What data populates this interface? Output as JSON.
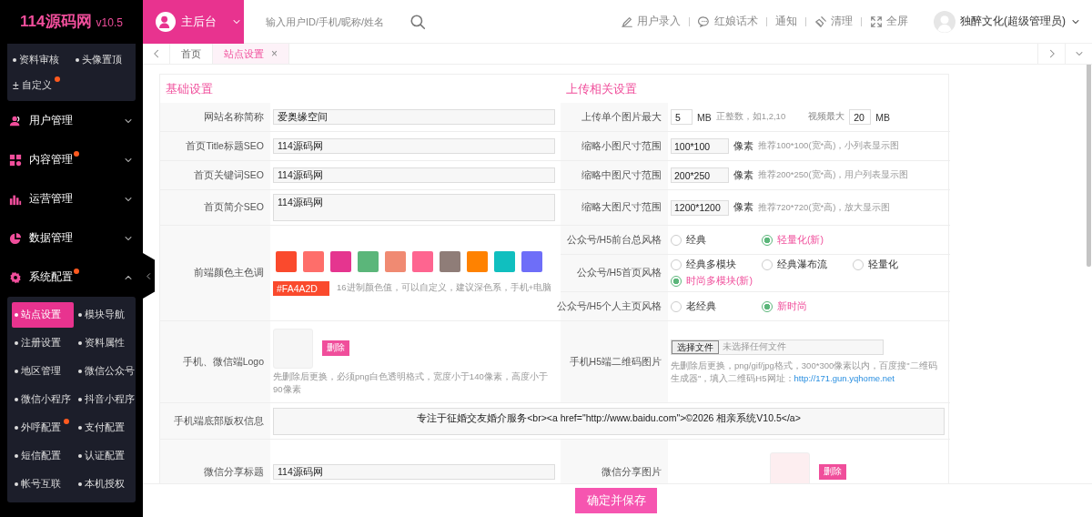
{
  "header": {
    "logo": "114源码网",
    "version": "v10.5",
    "console": "主后台",
    "search_placeholder": "输入用户ID/手机/昵称/姓名",
    "actions": [
      {
        "kind": "pen",
        "label": "用户录入"
      },
      {
        "kind": "chat",
        "label": "红娘话术"
      },
      {
        "kind": "plain",
        "label": "通知"
      },
      {
        "kind": "broom",
        "label": "清理"
      },
      {
        "kind": "expand",
        "label": "全屏"
      }
    ],
    "user": "独醉文化(超级管理员)"
  },
  "sidebar": {
    "top_items": [
      {
        "label": "资料审核",
        "dot": false
      },
      {
        "label": "头像置顶",
        "dot": false
      },
      {
        "label": "自定义",
        "symbol": "±",
        "dot": true
      }
    ],
    "menus": [
      {
        "kind": "user",
        "label": "用户管理",
        "dot": false,
        "expanded": false
      },
      {
        "kind": "grid",
        "label": "内容管理",
        "dot": true,
        "expanded": false
      },
      {
        "kind": "bars",
        "label": "运营管理",
        "dot": false,
        "expanded": false
      },
      {
        "kind": "pie",
        "label": "数据管理",
        "dot": false,
        "expanded": false
      },
      {
        "kind": "gear",
        "label": "系统配置",
        "dot": true,
        "expanded": true,
        "children": [
          {
            "label": "站点设置",
            "selected": true,
            "dot": false
          },
          {
            "label": "模块导航",
            "selected": false,
            "dot": false
          },
          {
            "label": "注册设置",
            "selected": false,
            "dot": false
          },
          {
            "label": "资料属性",
            "selected": false,
            "dot": false
          },
          {
            "label": "地区管理",
            "selected": false,
            "dot": false
          },
          {
            "label": "微信公众号",
            "selected": false,
            "dot": false
          },
          {
            "label": "微信小程序",
            "selected": false,
            "dot": false
          },
          {
            "label": "抖音小程序",
            "selected": false,
            "dot": false
          },
          {
            "label": "外呼配置",
            "selected": false,
            "dot": true
          },
          {
            "label": "支付配置",
            "selected": false,
            "dot": false
          },
          {
            "label": "短信配置",
            "selected": false,
            "dot": false
          },
          {
            "label": "认证配置",
            "selected": false,
            "dot": false
          },
          {
            "label": "帐号互联",
            "selected": false,
            "dot": false
          },
          {
            "label": "本机授权",
            "selected": false,
            "dot": false
          }
        ]
      }
    ]
  },
  "tabs": [
    {
      "label": "首页",
      "selected": false,
      "closable": false
    },
    {
      "label": "站点设置",
      "selected": true,
      "closable": true,
      "close": "×"
    }
  ],
  "form": {
    "left_title": "基础设置",
    "right_title": "上传相关设置",
    "left_fields": [
      {
        "kind": "text",
        "label": "网站名称简称",
        "value": "爱奥缘空间"
      },
      {
        "kind": "text",
        "label": "首页Title标题SEO",
        "value": "114源码网"
      },
      {
        "kind": "text",
        "label": "首页关键词SEO",
        "value": "114源码网"
      },
      {
        "kind": "textarea",
        "label": "首页简介SEO",
        "value": "114源码网"
      },
      {
        "kind": "colors",
        "label": "前端颜色主色调",
        "swatches": [
          {
            "color": "#fa4a2d"
          },
          {
            "color": "#fe6e6a"
          },
          {
            "color": "#e5358f"
          },
          {
            "color": "#5bb67a"
          },
          {
            "color": "#f08a72"
          },
          {
            "color": "#fe6590"
          },
          {
            "color": "#8f7d78"
          },
          {
            "color": "#ff8200"
          },
          {
            "color": "#10bfbf"
          },
          {
            "color": "#6e6ef8"
          }
        ],
        "value": "#FA4A2D",
        "color": "#fa4a2d",
        "hint": "16进制颜色值，可以自定义，建议深色系，手机+电脑"
      },
      {
        "kind": "image",
        "label": "手机、微信端Logo",
        "delete": "删除",
        "hint": "先删除后更换，必须png白色透明格式，宽度小于140像素，高度小于90像素"
      }
    ],
    "right_fields": [
      {
        "kind": "upload",
        "label": "上传单个图片最大",
        "value": "5",
        "unit": "MB",
        "hint": "正整数，如1,2,10",
        "label2": "视频最大",
        "value2": "20",
        "unit2": "MB"
      },
      {
        "kind": "size",
        "label": "缩略小图尺寸范围",
        "value": "100*100",
        "unit": "像素",
        "hint": "推荐100*100(宽*高)，小列表显示图"
      },
      {
        "kind": "size",
        "label": "缩略中图尺寸范围",
        "value": "200*250",
        "unit": "像素",
        "hint": "推荐200*250(宽*高)，用户列表显示图"
      },
      {
        "kind": "size",
        "label": "缩略大图尺寸范围",
        "value": "1200*1200",
        "unit": "像素",
        "hint": "推荐720*720(宽*高)，放大显示图"
      },
      {
        "kind": "radio",
        "label": "公众号/H5前台总风格",
        "options": [
          {
            "label": "经典",
            "selected": false
          },
          {
            "label": "轻量化(新)",
            "selected": true
          }
        ]
      },
      {
        "kind": "radio",
        "label": "公众号/H5首页风格",
        "options": [
          {
            "label": "经典多模块",
            "selected": false
          },
          {
            "label": "经典瀑布流",
            "selected": false
          },
          {
            "label": "轻量化",
            "selected": false
          },
          {
            "label": "时尚多模块(新)",
            "selected": true
          }
        ]
      },
      {
        "kind": "radio",
        "label": "公众号/H5个人主页风格",
        "options": [
          {
            "label": "老经典",
            "selected": false
          },
          {
            "label": "新时尚",
            "selected": true
          }
        ]
      },
      {
        "kind": "file",
        "label": "手机H5端二维码图片",
        "button": "选择文件",
        "status": "未选择任何文件",
        "hint": "先删除后更换，png/gif/jpg格式，300*300像素以内，百度搜\"二维码生成器\"，填入二维码H5网址：",
        "link": "http://171.gun.yqhome.net"
      }
    ],
    "footer_field": {
      "kind": "textarea",
      "label": "手机端底部版权信息",
      "value": "专注于征婚交友婚介服务<br><a href=\"http://www.baidu.com\">©2026 相亲系统V10.5</a>"
    },
    "last_left": {
      "kind": "text",
      "label": "微信分享标题",
      "value": "114源码网"
    },
    "last_right": {
      "kind": "image",
      "label": "微信分享图片",
      "delete": "删除"
    }
  },
  "save_button": "确定并保存"
}
